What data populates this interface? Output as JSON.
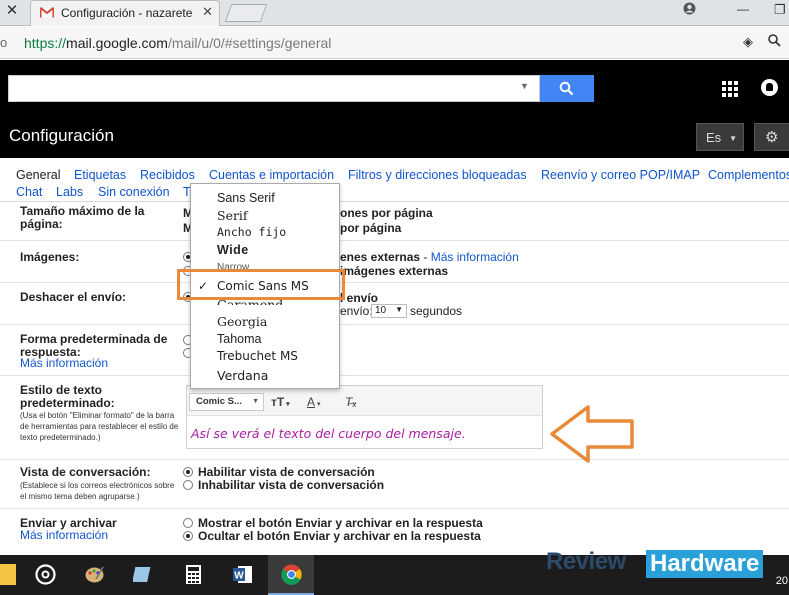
{
  "browser": {
    "tab_title": "Configuración - nazarete",
    "url_prefix": "https://",
    "url_host": "mail.google.com",
    "url_path": "/mail/u/0/#settings/general",
    "left_glyph": "o"
  },
  "header": {
    "page_title": "Configuración",
    "lang_button": "Es"
  },
  "tabs": {
    "row1": [
      "General",
      "Etiquetas",
      "Recibidos",
      "Cuentas e importación",
      "Filtros y direcciones bloqueadas",
      "Reenvío y correo POP/IMAP",
      "Complementos"
    ],
    "row2": [
      "Chat",
      "Labs",
      "Sin conexión",
      "T"
    ]
  },
  "settings": {
    "max_size": {
      "label": "Tamaño máximo de la página:",
      "line1_prefix": "M",
      "line1_suffix": "ones por página",
      "line2_prefix": "M",
      "line2_suffix": "por página"
    },
    "images": {
      "label": "Imágenes:",
      "opt1_text": "enes externas",
      "opt1_sep": " - ",
      "opt1_link": "Más información",
      "opt2_text": "imágenes externas"
    },
    "undo_send": {
      "label": "Deshacer el envío:",
      "line1": "l envío",
      "line2_prefix": "envío:",
      "seconds_value": "10",
      "line2_suffix": "segundos"
    },
    "reply": {
      "label": "Forma predeterminada de respuesta:",
      "link": "Más información"
    },
    "text_style": {
      "label": "Estilo de texto predeterminado:",
      "note": "(Usa el botón \"Eliminar formato\" de la barra de herramientas para restablecer el estilo de texto predeterminado.)",
      "font_selector": "Comic S...",
      "preview": "Así se verá el texto del cuerpo del mensaje."
    },
    "conversation": {
      "label": "Vista de conversación:",
      "note": "(Establece si los correos electrónicos sobre el mismo tema deben agruparse.)",
      "opt1": "Habilitar vista de conversación",
      "opt2": "Inhabilitar vista de conversación"
    },
    "send_archive": {
      "label": "Enviar y archivar",
      "link": "Más información",
      "opt1": "Mostrar el botón Enviar y archivar en la respuesta",
      "opt2": "Ocultar el botón Enviar y archivar en la respuesta"
    }
  },
  "font_menu": {
    "items": [
      "Sans Serif",
      "Serif",
      "Ancho fijo",
      "Wide",
      "Narrow",
      "Comic Sans MS",
      "Garamond",
      "Georgia",
      "Tahoma",
      "Trebuchet MS",
      "Verdana"
    ],
    "selected": "Comic Sans MS",
    "check": "✓"
  },
  "taskbar": {
    "clock": "20"
  },
  "watermark": {
    "part1": "Review",
    "part2": "Hardware"
  },
  "colors": {
    "accent_link": "#1155cc",
    "search_button": "#4285f4",
    "highlight": "#e98a3a",
    "preview_text": "#a81fa0"
  }
}
